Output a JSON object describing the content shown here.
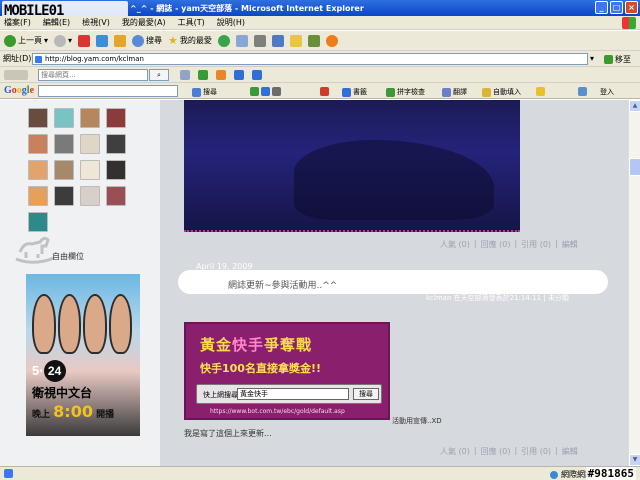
{
  "window": {
    "logo_text": "MOBILE01",
    "title": "^_^ - 網誌 - yam天空部落 - Microsoft Internet Explorer"
  },
  "menu": {
    "items": [
      "檔案(F)",
      "編輯(E)",
      "檢視(V)",
      "我的最愛(A)",
      "工具(T)",
      "說明(H)"
    ]
  },
  "toolbar": {
    "back_label": "上一頁",
    "search_label": "搜尋",
    "favorites_label": "我的最愛"
  },
  "address": {
    "label": "網址(D)",
    "url": "http://blog.yam.com/kclman",
    "go_label": "移至"
  },
  "searchbar": {
    "placeholder": "搜尋網頁..."
  },
  "googlebar": {
    "logo": "Google",
    "search_label": "搜尋",
    "bookmarks_label": "書籤",
    "spellcheck_label": "拼字檢查",
    "translate_label": "翻譯",
    "autofill_label": "自動填入",
    "login_label": "登入"
  },
  "sidebar": {
    "section_label": "自由欄位",
    "ad": {
      "date_num": "5",
      "date_day": "24",
      "channel": "衛視中文台",
      "time_prefix": "晚上",
      "time": "8:00",
      "time_suffix": "開播"
    }
  },
  "post1": {
    "links": [
      "人氣 (0)",
      "回應 (0)",
      "引用 (0)",
      "編輯"
    ]
  },
  "post2": {
    "date": "April 19, 2009",
    "title": "網誌更新~參與活動用..^^",
    "byline": "kclman 在天空部落發表於21:14:11 | 未分類",
    "ad": {
      "headline_a": "黃金",
      "headline_b": "快手",
      "headline_c": "爭奪戰",
      "sub": "快手100名直接拿獎金!!",
      "search_label": "快上網搜尋",
      "search_value": "黃金快手",
      "search_button": "搜尋",
      "url": "https://www.bot.com.tw/ebc/gold/default.asp"
    },
    "after_ad": "活動用宣傳..XD",
    "body": "我是寫了這個上來更新...",
    "links": [
      "人氣 (0)",
      "回應 (0)",
      "引用 (0)",
      "編輯"
    ]
  },
  "status": {
    "zone": "網際網路",
    "watermark": "#981865"
  }
}
